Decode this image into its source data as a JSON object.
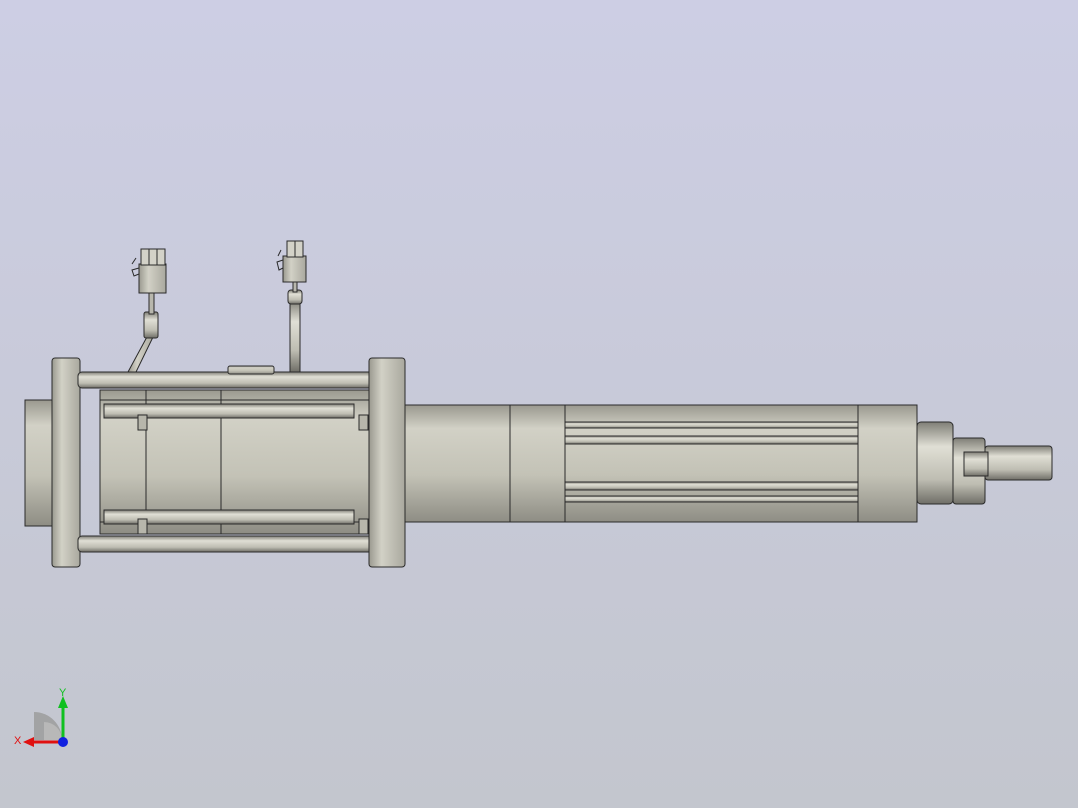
{
  "viewport": {
    "background_top": "#cdcee4",
    "background_bottom": "#c3c6ce"
  },
  "model": {
    "icon": "linear-actuator-icon",
    "body_color": "#c3c2b6",
    "edge_color": "#2a2a2a",
    "shadow_color": "#8e8d84"
  },
  "triad": {
    "x_label": "X",
    "y_label": "Y",
    "x_color": "#e01010",
    "y_color": "#10c020",
    "z_color": "#1020e0"
  }
}
